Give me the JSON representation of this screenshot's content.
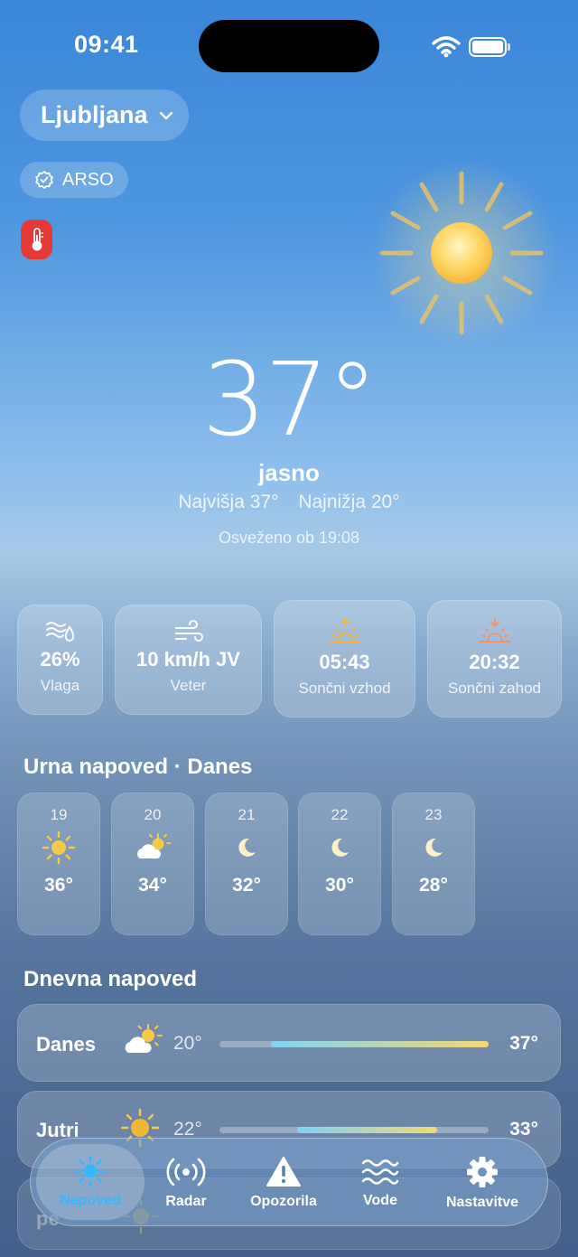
{
  "status": {
    "time": "09:41"
  },
  "location": {
    "city": "Ljubljana",
    "source": "ARSO"
  },
  "current": {
    "temperature": "37°",
    "condition": "jasno",
    "high": "Najvišja 37°",
    "low": "Najnižja 20°",
    "updated": "Osveženo ob 19:08"
  },
  "stats": [
    {
      "value": "26%",
      "label": "Vlaga",
      "icon": "humidity-icon"
    },
    {
      "value": "10 km/h JV",
      "label": "Veter",
      "icon": "wind-icon"
    },
    {
      "value": "05:43",
      "label": "Sončni vzhod",
      "icon": "sunrise-icon"
    },
    {
      "value": "20:32",
      "label": "Sončni zahod",
      "icon": "sunset-icon"
    }
  ],
  "hourly": {
    "title": "Urna napoved · Danes",
    "items": [
      {
        "hour": "19",
        "temp": "36°",
        "icon": "sun-icon"
      },
      {
        "hour": "20",
        "temp": "34°",
        "icon": "partly-cloudy-icon"
      },
      {
        "hour": "21",
        "temp": "32°",
        "icon": "moon-icon"
      },
      {
        "hour": "22",
        "temp": "30°",
        "icon": "moon-icon"
      },
      {
        "hour": "23",
        "temp": "28°",
        "icon": "moon-icon"
      }
    ]
  },
  "daily": {
    "title": "Dnevna napoved",
    "items": [
      {
        "day": "Danes",
        "low": "20°",
        "high": "37°",
        "icon": "partly-cloudy-icon",
        "range_start": 0.19,
        "range_end": 1.0
      },
      {
        "day": "Jutri",
        "low": "22°",
        "high": "33°",
        "icon": "sun-icon",
        "range_start": 0.29,
        "range_end": 0.81
      },
      {
        "day": "pe",
        "icon": "sun-icon"
      }
    ]
  },
  "tabs": [
    {
      "label": "Napoved",
      "icon": "sun-icon",
      "active": true
    },
    {
      "label": "Radar",
      "icon": "radar-icon",
      "active": false
    },
    {
      "label": "Opozorila",
      "icon": "warning-icon",
      "active": false
    },
    {
      "label": "Vode",
      "icon": "waves-icon",
      "active": false
    },
    {
      "label": "Nastavitve",
      "icon": "gear-icon",
      "active": false
    }
  ],
  "colors": {
    "accent": "#36b8ff",
    "alert": "#e53935",
    "sun": "#f7c948"
  }
}
